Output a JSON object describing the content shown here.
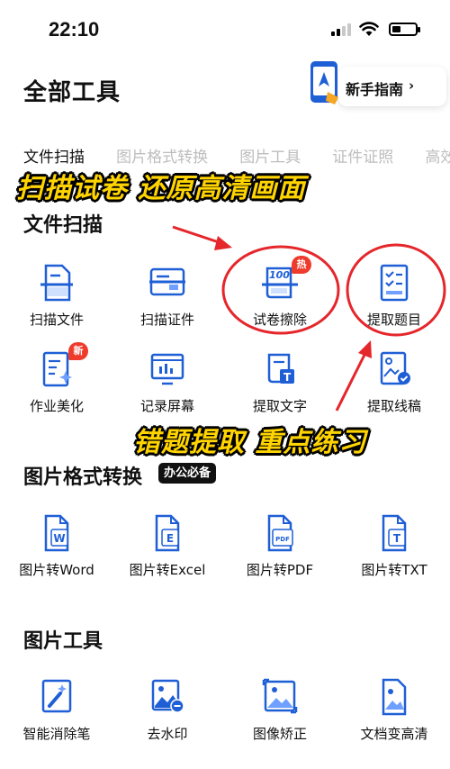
{
  "status": {
    "time": "22:10"
  },
  "header": {
    "title": "全部工具",
    "guide_label": "新手指南",
    "guide_chevron": "›"
  },
  "tabs": [
    "文件扫描",
    "图片格式转换",
    "图片工具",
    "证件证照",
    "高效"
  ],
  "annotations": {
    "banner_top": "扫描试卷 还原高清画面",
    "banner_mid": "错题提取 重点练习"
  },
  "sections": [
    {
      "title": "文件扫描",
      "tools": [
        {
          "label": "扫描文件",
          "icon": "scan-document-icon"
        },
        {
          "label": "扫描证件",
          "icon": "scan-id-card-icon"
        },
        {
          "label": "试卷擦除",
          "icon": "exam-erase-icon",
          "badge": "热"
        },
        {
          "label": "提取题目",
          "icon": "extract-questions-icon"
        },
        {
          "label": "作业美化",
          "icon": "homework-beautify-icon",
          "badge": "新"
        },
        {
          "label": "记录屏幕",
          "icon": "record-screen-icon"
        },
        {
          "label": "提取文字",
          "icon": "extract-text-icon"
        },
        {
          "label": "提取线稿",
          "icon": "extract-lineart-icon"
        }
      ]
    },
    {
      "title": "图片格式转换",
      "tag": "办公必备",
      "tools": [
        {
          "label": "图片转Word",
          "icon": "to-word-icon",
          "glyph": "W"
        },
        {
          "label": "图片转Excel",
          "icon": "to-excel-icon",
          "glyph": "E"
        },
        {
          "label": "图片转PDF",
          "icon": "to-pdf-icon",
          "glyph": "PDF"
        },
        {
          "label": "图片转TXT",
          "icon": "to-txt-icon",
          "glyph": "T"
        }
      ]
    },
    {
      "title": "图片工具",
      "tools": [
        {
          "label": "智能消除笔",
          "icon": "magic-eraser-icon"
        },
        {
          "label": "去水印",
          "icon": "remove-watermark-icon"
        },
        {
          "label": "图像矫正",
          "icon": "image-correct-icon"
        },
        {
          "label": "文档变高清",
          "icon": "document-hd-icon"
        }
      ]
    }
  ],
  "colors": {
    "accent": "#1f5fd6",
    "badge": "#ef3b2c",
    "annotation": "#e5262b",
    "banner": "#ffd400"
  }
}
